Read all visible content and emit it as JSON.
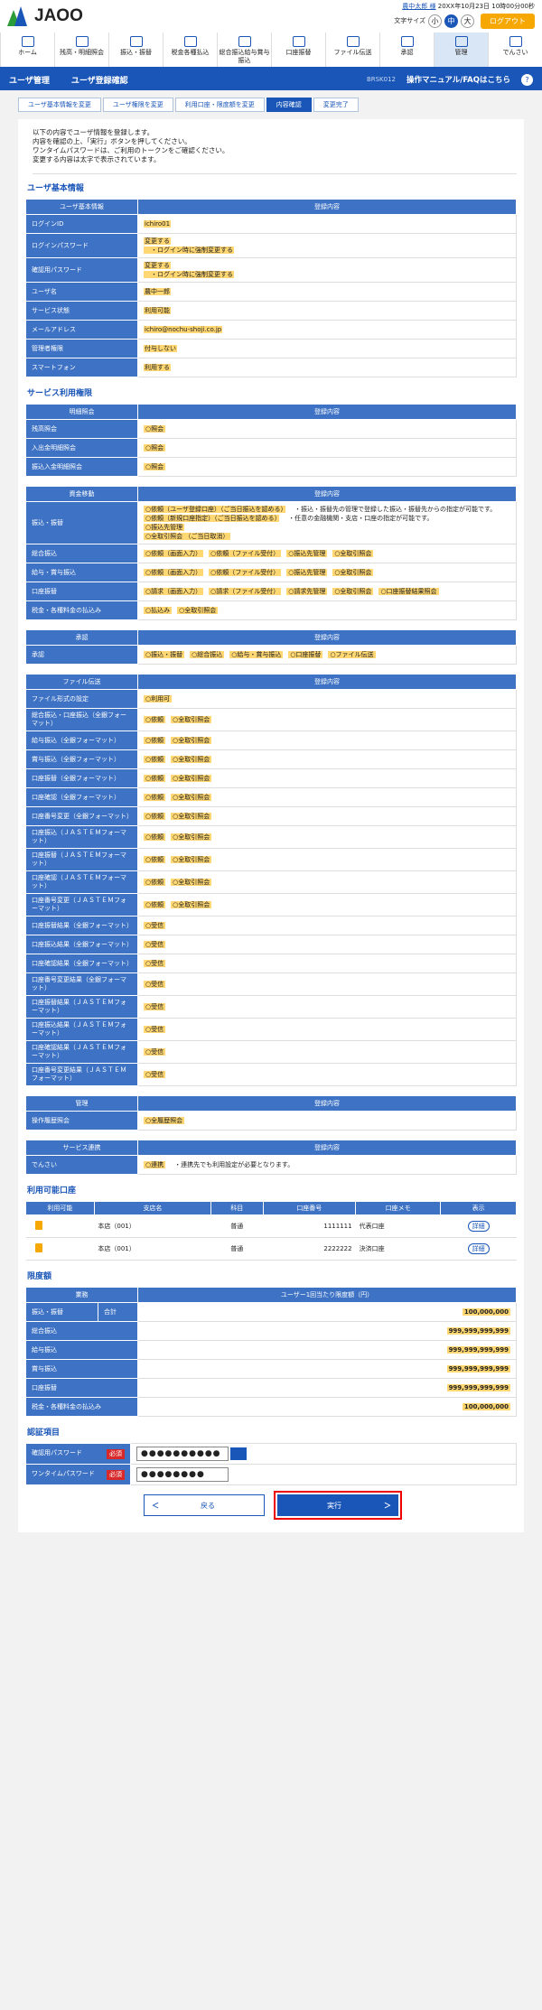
{
  "header": {
    "logo": "JAOO",
    "user": "農中太郎 様",
    "last_login": "20XX年10月23日 10時00分00秒",
    "font_size_label": "文字サイズ",
    "font_small": "小",
    "font_mid": "中",
    "font_large": "大",
    "logout": "ログアウト"
  },
  "nav": [
    "ホーム",
    "残高・明細照会",
    "振込・振替",
    "税金各種払込",
    "総合振込給与賞与振込",
    "口座振替",
    "ファイル伝送",
    "承認",
    "管理",
    "でんさい"
  ],
  "title": {
    "section": "ユーザ管理",
    "page": "ユーザ登録確認",
    "code": "BRSK012",
    "help": "操作マニュアル/FAQはこちら",
    "q": "?"
  },
  "steps": [
    "ユーザ基本情報を変更",
    "ユーザ権限を変更",
    "利用口座・限度額を変更",
    "内容確認",
    "変更完了"
  ],
  "message": [
    "以下の内容でユーザ情報を登録します。",
    "内容を確認の上、「実行」ボタンを押してください。",
    "ワンタイムパスワードは、ご利用のトークンをご確認ください。",
    "変更する内容は太字で表示されています。"
  ],
  "basic": {
    "heading": "ユーザ基本情報",
    "col1": "ユーザ基本情報",
    "col2": "登録内容",
    "rows": [
      [
        "ログインID",
        "ichiro01",
        ""
      ],
      [
        "ログインパスワード",
        "変更する",
        "・ログイン時に強制変更する"
      ],
      [
        "確認用パスワード",
        "変更する",
        "・ログイン時に強制変更する"
      ],
      [
        "ユーザ名",
        "農中一郎",
        ""
      ],
      [
        "サービス状態",
        "利用可能",
        ""
      ],
      [
        "メールアドレス",
        "ichiro@nochu-shoji.co.jp",
        ""
      ],
      [
        "管理者権限",
        "付与しない",
        ""
      ],
      [
        "スマートフォン",
        "利用する",
        ""
      ]
    ]
  },
  "service": {
    "heading": "サービス利用権限",
    "col2": "登録内容",
    "inquiry": {
      "head": "明細照会",
      "rows": [
        [
          "残高照会",
          "照会"
        ],
        [
          "入出金明細照会",
          "照会"
        ],
        [
          "振込入金明細照会",
          "照会"
        ]
      ]
    },
    "funds": {
      "head": "資金移動",
      "furikomi": [
        "依頼（ユーザ登録口座）",
        "（ご当日振込を認める）",
        "・振込・振替先の管理で登録した振込・振替先からの指定が可能です。",
        "依頼（新規口座指定）",
        "（ご当日振込を認める）",
        "・任意の金融機関・支店・口座の指定が可能です。",
        "振込先管理",
        "全取引照会",
        "（ご当日取消）"
      ],
      "rows": [
        [
          "総合振込",
          [
            "依頼（画面入力）",
            "依頼（ファイル受付）",
            "振込先管理",
            "全取引照会"
          ]
        ],
        [
          "給与・賞与振込",
          [
            "依頼（画面入力）",
            "依頼（ファイル受付）",
            "振込先管理",
            "全取引照会"
          ]
        ],
        [
          "口座振替",
          [
            "請求（画面入力）",
            "請求（ファイル受付）",
            "請求先管理",
            "全取引照会",
            "口座振替結果照会"
          ]
        ],
        [
          "税金・各種料金の払込み",
          [
            "払込み",
            "全取引照会"
          ]
        ]
      ],
      "furikomi_label": "振込・振替"
    },
    "approval": {
      "head": "承認",
      "label": "承認",
      "items": [
        "振込・振替",
        "総合振込",
        "給与・賞与振込",
        "口座振替",
        "ファイル伝送"
      ]
    },
    "file": {
      "head": "ファイル伝送",
      "rows": [
        [
          "ファイル形式の設定",
          [
            "利用可"
          ]
        ],
        [
          "総合振込・口座振込（全銀フォーマット）",
          [
            "依頼",
            "全取引照会"
          ]
        ],
        [
          "給与振込（全銀フォーマット）",
          [
            "依頼",
            "全取引照会"
          ]
        ],
        [
          "賞与振込（全銀フォーマット）",
          [
            "依頼",
            "全取引照会"
          ]
        ],
        [
          "口座振替（全銀フォーマット）",
          [
            "依頼",
            "全取引照会"
          ]
        ],
        [
          "口座確認（全銀フォーマット）",
          [
            "依頼",
            "全取引照会"
          ]
        ],
        [
          "口座番号変更（全銀フォーマット）",
          [
            "依頼",
            "全取引照会"
          ]
        ],
        [
          "口座振込（ＪＡＳＴＥＭフォーマット）",
          [
            "依頼",
            "全取引照会"
          ]
        ],
        [
          "口座振替（ＪＡＳＴＥＭフォーマット）",
          [
            "依頼",
            "全取引照会"
          ]
        ],
        [
          "口座確認（ＪＡＳＴＥＭフォーマット）",
          [
            "依頼",
            "全取引照会"
          ]
        ],
        [
          "口座番号変更（ＪＡＳＴＥＭフォーマット）",
          [
            "依頼",
            "全取引照会"
          ]
        ],
        [
          "口座振替結果（全銀フォーマット）",
          [
            "受信"
          ]
        ],
        [
          "口座振込結果（全銀フォーマット）",
          [
            "受信"
          ]
        ],
        [
          "口座確認結果（全銀フォーマット）",
          [
            "受信"
          ]
        ],
        [
          "口座番号変更結果（全銀フォーマット）",
          [
            "受信"
          ]
        ],
        [
          "口座振替結果（ＪＡＳＴＥＭフォーマット）",
          [
            "受信"
          ]
        ],
        [
          "口座振込結果（ＪＡＳＴＥＭフォーマット）",
          [
            "受信"
          ]
        ],
        [
          "口座確認結果（ＪＡＳＴＥＭフォーマット）",
          [
            "受信"
          ]
        ],
        [
          "口座番号変更結果（ＪＡＳＴＥＭフォーマット）",
          [
            "受信"
          ]
        ]
      ]
    },
    "admin": {
      "head": "管理",
      "label": "操作履歴照会",
      "items": [
        "全履歴照会"
      ]
    },
    "densai": {
      "head": "サービス連携",
      "label": "でんさい",
      "items": [
        "連携"
      ],
      "note": "・連携先でも利用設定が必要となります。"
    }
  },
  "accounts": {
    "heading": "利用可能口座",
    "cols": [
      "利用可能",
      "支店名",
      "科目",
      "口座番号",
      "口座メモ",
      "表示"
    ],
    "rows": [
      [
        "本店（001）",
        "普通",
        "1111111",
        "代表口座",
        "詳細"
      ],
      [
        "本店（001）",
        "普通",
        "2222222",
        "決済口座",
        "詳細"
      ]
    ]
  },
  "limits": {
    "heading": "限度額",
    "col1": "業務",
    "col2": "ユーザー1回当たり限度額（円）",
    "rows": [
      [
        "振込・振替",
        "合計",
        "100,000,000"
      ],
      [
        "総合振込",
        "",
        "999,999,999,999"
      ],
      [
        "給与振込",
        "",
        "999,999,999,999"
      ],
      [
        "賞与振込",
        "",
        "999,999,999,999"
      ],
      [
        "口座振替",
        "",
        "999,999,999,999"
      ],
      [
        "税金・各種料金の払込み",
        "",
        "100,000,000"
      ]
    ]
  },
  "auth": {
    "heading": "認証項目",
    "rows": [
      [
        "確認用パスワード",
        "必須",
        "●●●●●●●●●●"
      ],
      [
        "ワンタイムパスワード",
        "必須",
        "●●●●●●●●"
      ]
    ]
  },
  "buttons": {
    "back": "戻る",
    "exec": "実行",
    "back_arrow": "＜",
    "exec_arrow": "＞"
  },
  "colors": {
    "primary": "#1a56b8",
    "highlight": "#ffd773",
    "logout": "#f6a700"
  }
}
